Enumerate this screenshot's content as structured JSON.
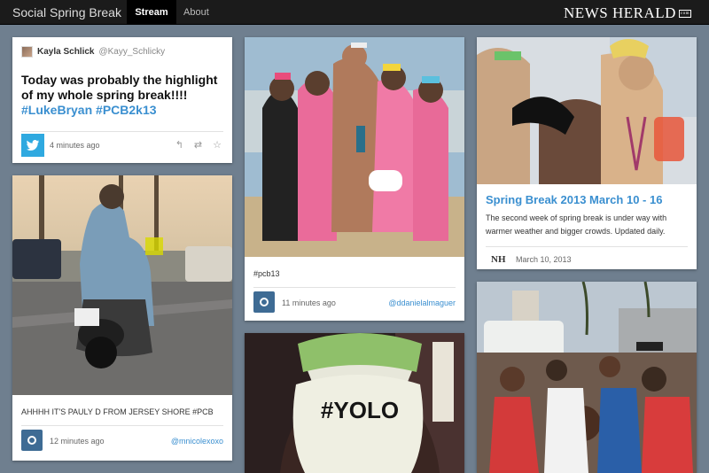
{
  "nav": {
    "brand": "Social Spring Break",
    "tabs": [
      "Stream",
      "About"
    ],
    "masthead": "NEWS HERALD",
    "masthead_suffix": "com"
  },
  "tweet": {
    "name": "Kayla Schlick",
    "handle": "@Kayy_Schlicky",
    "text_plain": "Today was probably the highlight of my whole spring break!!!! ",
    "tag1": "#LukeBryan",
    "tag2": "#PCB2k13",
    "time": "4 minutes ago",
    "icons": [
      "reply-icon",
      "retweet-icon",
      "favorite-icon"
    ]
  },
  "posts": [
    {
      "caption": "#pcb13",
      "time": "11 minutes ago",
      "user": "@ddanielalmaguer"
    },
    {
      "caption": "AHHHH IT'S PAULY D FROM JERSEY SHORE #PCB",
      "time": "12 minutes ago",
      "user": "@mnicolexoxo"
    }
  ],
  "article": {
    "title": "Spring Break 2013 March 10 - 16",
    "body": "The second week of spring break is under way with warmer weather and bigger crowds. Updated daily.",
    "source_logo": "NH",
    "date": "March 10, 2013"
  },
  "yolo_hat_text": "#YOLO",
  "colors": {
    "accent": "#3a8fd0",
    "twitter": "#2fa9e0",
    "instagram": "#3e6b94",
    "page_bg": "#6f7f8f",
    "nav_bg": "#1b1b1b"
  }
}
